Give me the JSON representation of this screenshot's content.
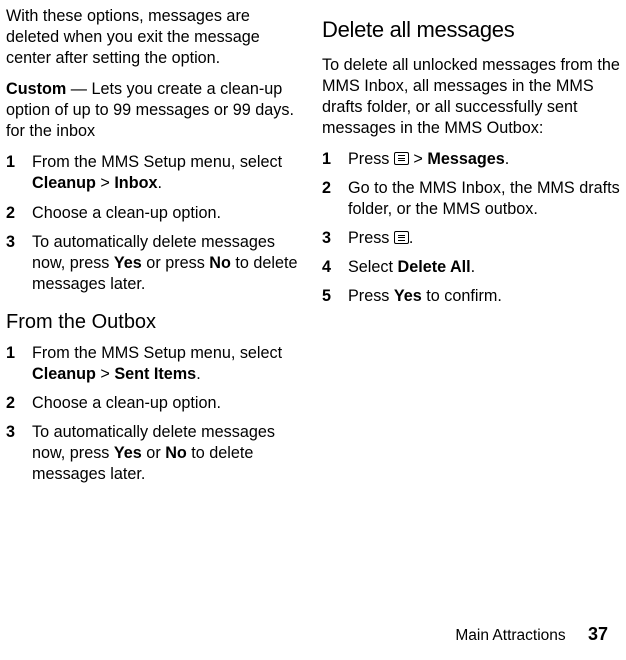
{
  "col1": {
    "intro_para": "With these options, messages are deleted when you exit the message center after setting the option.",
    "custom_label": "Custom",
    "custom_desc": " — Lets you create a clean-up option of up to 99 messages or 99 days. for the inbox",
    "inbox_steps": {
      "s1_lead": "From the MMS Setup menu, select ",
      "s1_b1": "Cleanup",
      "s1_mid": " > ",
      "s1_b2": "Inbox",
      "s1_tail": ".",
      "s2": "Choose a clean-up option.",
      "s3_lead": "To automatically delete messages now, press ",
      "s3_b1": "Yes",
      "s3_mid": " or press ",
      "s3_b2": "No",
      "s3_tail": " to delete messages later."
    },
    "outbox_heading": "From the Outbox",
    "outbox_steps": {
      "s1_lead": "From the MMS Setup menu, select ",
      "s1_b1": "Cleanup",
      "s1_mid": " > ",
      "s1_b2": "Sent Items",
      "s1_tail": ".",
      "s2": "Choose a clean-up option.",
      "s3_lead": "To automatically delete messages now, press ",
      "s3_b1": "Yes",
      "s3_mid": " or ",
      "s3_b2": "No",
      "s3_tail": " to delete messages later."
    }
  },
  "col2": {
    "heading": "Delete all messages",
    "intro": "To delete all unlocked messages from the MMS Inbox, all messages in the MMS drafts folder, or all successfully sent messages in the MMS Outbox:",
    "steps": {
      "s1_lead": "Press ",
      "s1_mid": " > ",
      "s1_b1": "Messages",
      "s1_tail": ".",
      "s2": "Go to the MMS Inbox, the MMS drafts folder, or the MMS outbox.",
      "s3_lead": "Press ",
      "s3_tail": ".",
      "s4_lead": "Select ",
      "s4_b1": "Delete All",
      "s4_tail": ".",
      "s5_lead": "Press ",
      "s5_b1": "Yes",
      "s5_tail": " to confirm."
    }
  },
  "nums": {
    "n1": "1",
    "n2": "2",
    "n3": "3",
    "n4": "4",
    "n5": "5"
  },
  "footer": {
    "section": "Main Attractions",
    "page": "37"
  }
}
